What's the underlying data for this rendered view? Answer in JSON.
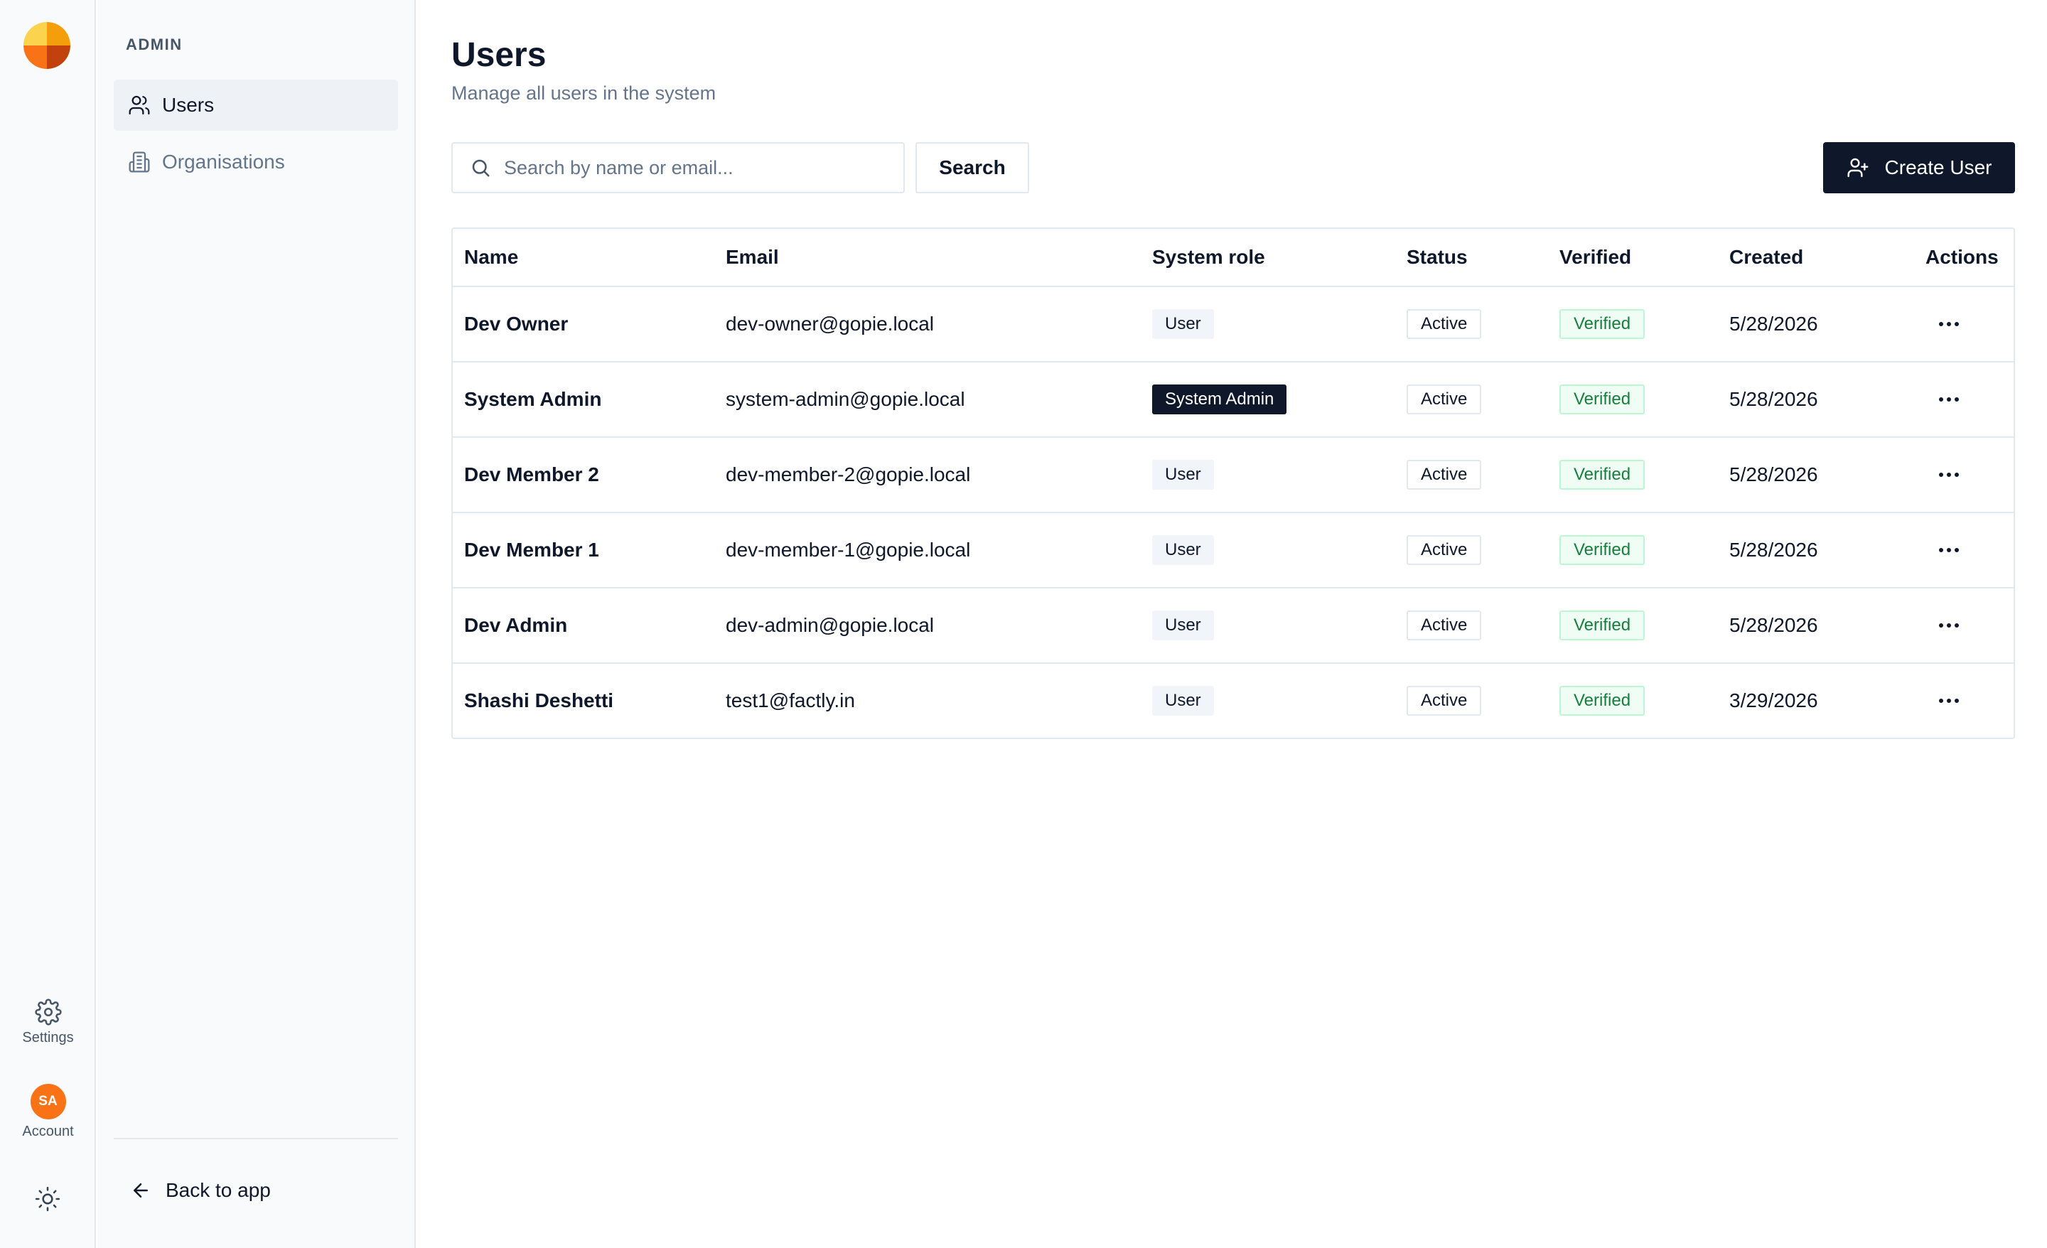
{
  "rail": {
    "settings_label": "Settings",
    "account_label": "Account",
    "avatar_initials": "SA",
    "avatar_color": "#f97316"
  },
  "sidebar": {
    "section_label": "ADMIN",
    "items": [
      {
        "label": "Users",
        "icon": "users-icon",
        "active": true
      },
      {
        "label": "Organisations",
        "icon": "building-icon",
        "active": false
      }
    ],
    "back_label": "Back to app"
  },
  "main": {
    "title": "Users",
    "subtitle": "Manage all users in the system",
    "search": {
      "placeholder": "Search by name or email...",
      "value": ""
    },
    "search_button": "Search",
    "create_button": "Create User"
  },
  "table": {
    "columns": [
      "Name",
      "Email",
      "System role",
      "Status",
      "Verified",
      "Created",
      "Actions"
    ],
    "rows": [
      {
        "name": "Dev Owner",
        "email": "dev-owner@gopie.local",
        "role": "User",
        "status": "Active",
        "verified": "Verified",
        "created": "5/28/2026"
      },
      {
        "name": "System Admin",
        "email": "system-admin@gopie.local",
        "role": "System Admin",
        "status": "Active",
        "verified": "Verified",
        "created": "5/28/2026"
      },
      {
        "name": "Dev Member 2",
        "email": "dev-member-2@gopie.local",
        "role": "User",
        "status": "Active",
        "verified": "Verified",
        "created": "5/28/2026"
      },
      {
        "name": "Dev Member 1",
        "email": "dev-member-1@gopie.local",
        "role": "User",
        "status": "Active",
        "verified": "Verified",
        "created": "5/28/2026"
      },
      {
        "name": "Dev Admin",
        "email": "dev-admin@gopie.local",
        "role": "User",
        "status": "Active",
        "verified": "Verified",
        "created": "5/28/2026"
      },
      {
        "name": "Shashi Deshetti",
        "email": "test1@factly.in",
        "role": "User",
        "status": "Active",
        "verified": "Verified",
        "created": "3/29/2026"
      }
    ]
  },
  "colors": {
    "primary": "#0f172a",
    "verified_green": "#15803d",
    "logo_orange": "#f97316"
  }
}
